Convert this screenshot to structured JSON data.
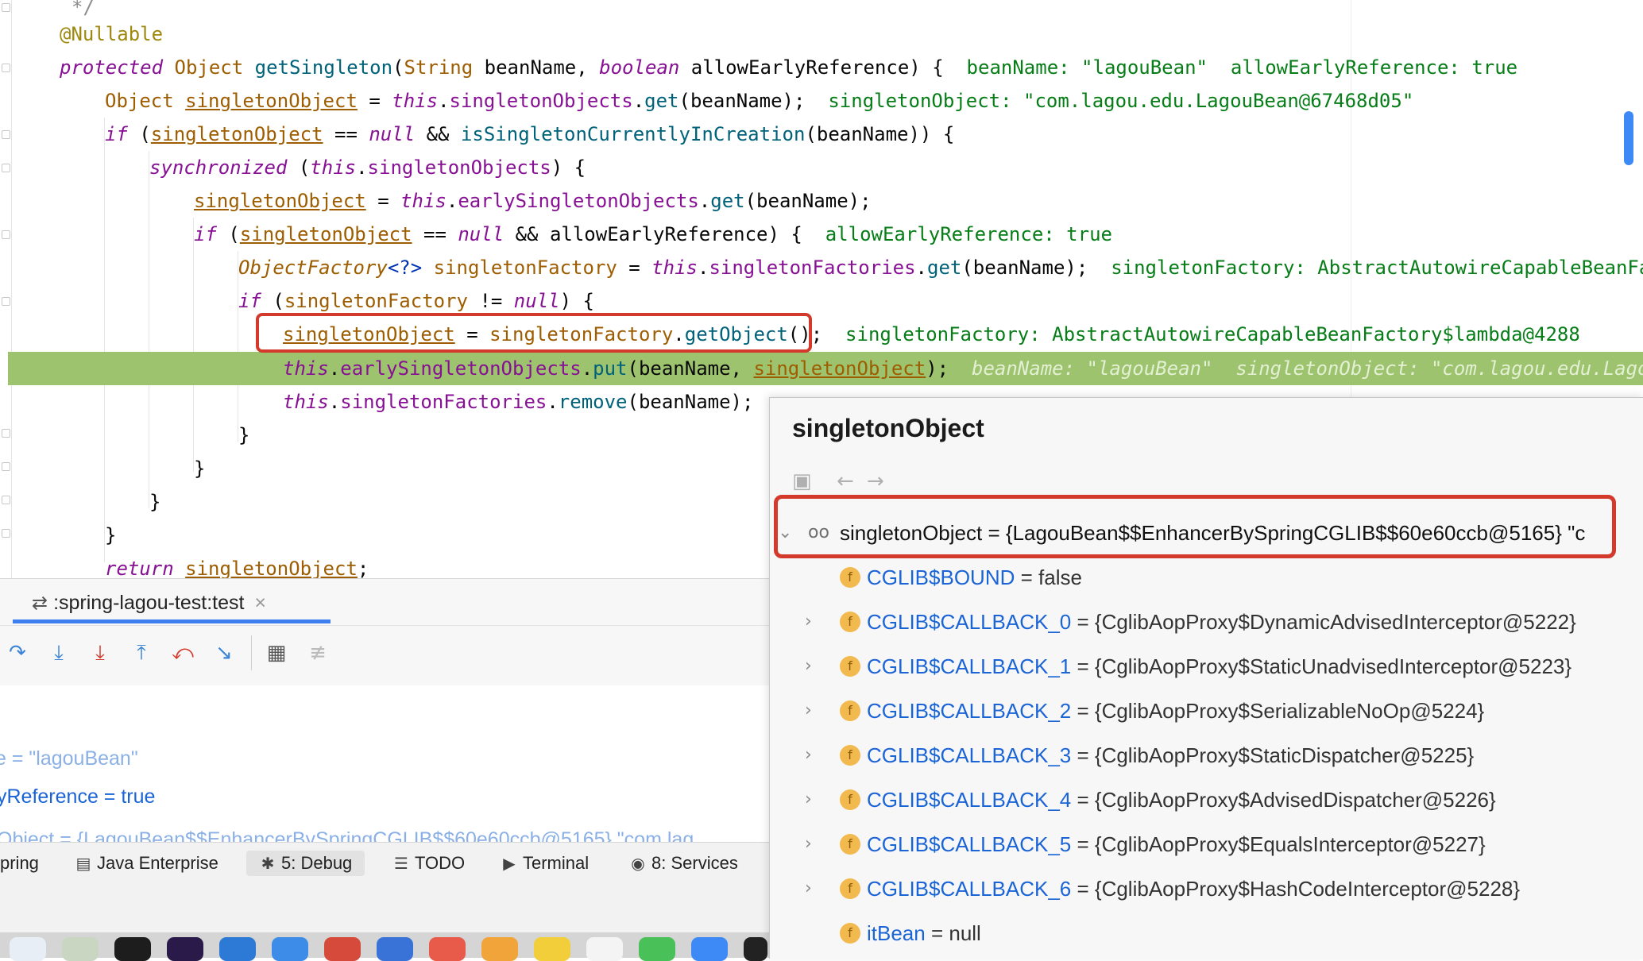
{
  "editor": {
    "lines": [
      "*/",
      "@Nullable",
      "protected Object getSingleton(String beanName, boolean allowEarlyReference) {",
      "Object singletonObject = this.singletonObjects.get(beanName);",
      "if (singletonObject == null && isSingletonCurrentlyInCreation(beanName)) {",
      "synchronized (this.singletonObjects) {",
      "singletonObject = this.earlySingletonObjects.get(beanName);",
      "if (singletonObject == null && allowEarlyReference) {",
      "ObjectFactory<?> singletonFactory = this.singletonFactories.get(beanName);",
      "if (singletonFactory != null) {",
      "singletonObject = singletonFactory.getObject();",
      "this.earlySingletonObjects.put(beanName, singletonObject);",
      "this.singletonFactories.remove(beanName);",
      "}",
      "}",
      "}",
      "}",
      "return singletonObject;"
    ],
    "hints": {
      "line2": "beanName: \"lagouBean\"  allowEarlyReference: true",
      "line3": "singletonObject: \"com.lagou.edu.LagouBean@67468d05\"",
      "line7": "allowEarlyReference: true",
      "line8": "singletonFactory: AbstractAutowireCapableBeanFacto",
      "line10": "singletonFactory: AbstractAutowireCapableBeanFactory$lambda@4288",
      "line11": "beanName: \"lagouBean\"  singletonObject: \"com.lagou.edu.LagouBe"
    }
  },
  "debug": {
    "tab_label": ":spring-lagou-test:test",
    "vars_left": [
      "e = \"lagouBean\"",
      "yReference = true",
      "Object = {LagouBean$$EnhancerBySpringCGLIB$$60e60ccb@5165} \"com.lag"
    ]
  },
  "statusbar": {
    "items": [
      "pring",
      "Java Enterprise",
      "5: Debug",
      "TODO",
      "Terminal",
      "8: Services"
    ]
  },
  "popup": {
    "title": "singletonObject",
    "root": "singletonObject = {LagouBean$$EnhancerBySpringCGLIB$$60e60ccb@5165} \"c",
    "fields": [
      {
        "name": "CGLIB$BOUND",
        "value": " = false",
        "expandable": false
      },
      {
        "name": "CGLIB$CALLBACK_0",
        "value": " = {CglibAopProxy$DynamicAdvisedInterceptor@5222}",
        "expandable": true
      },
      {
        "name": "CGLIB$CALLBACK_1",
        "value": " = {CglibAopProxy$StaticUnadvisedInterceptor@5223}",
        "expandable": true
      },
      {
        "name": "CGLIB$CALLBACK_2",
        "value": " = {CglibAopProxy$SerializableNoOp@5224}",
        "expandable": true
      },
      {
        "name": "CGLIB$CALLBACK_3",
        "value": " = {CglibAopProxy$StaticDispatcher@5225}",
        "expandable": true
      },
      {
        "name": "CGLIB$CALLBACK_4",
        "value": " = {CglibAopProxy$AdvisedDispatcher@5226}",
        "expandable": true
      },
      {
        "name": "CGLIB$CALLBACK_5",
        "value": " = {CglibAopProxy$EqualsInterceptor@5227}",
        "expandable": true
      },
      {
        "name": "CGLIB$CALLBACK_6",
        "value": " = {CglibAopProxy$HashCodeInterceptor@5228}",
        "expandable": true
      },
      {
        "name": "itBean",
        "value": " = null",
        "expandable": false
      }
    ]
  },
  "colors": {
    "execution_line": "#9dc36e",
    "highlight_box": "#d43a2c",
    "field_name": "#1a64d6",
    "field_icon": "#f2b94e"
  },
  "icons": [
    "fold-icon",
    "step-over-icon",
    "step-into-icon",
    "force-step-into-icon",
    "step-out-icon",
    "drop-frame-icon",
    "run-to-cursor-icon",
    "evaluate-icon",
    "trace-icon",
    "back-icon",
    "forward-icon",
    "watch-glasses-icon",
    "field-icon"
  ]
}
